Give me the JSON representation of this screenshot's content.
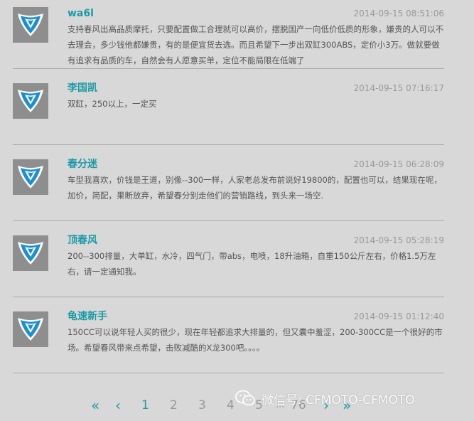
{
  "comments": [
    {
      "author": "wa6l",
      "date": "2014-09-15 08:51:06",
      "text": "支持春风出高品质摩托，只要配置做工合理就可以高价，摆脱国产一向低价低质的形象，嫌贵的人可以不去理会，多少钱他都嫌贵，有的是便宜货去选。而且希望下一步出双缸300ABS，定价小3万。做就要做有追求有品质的车，自然会有人愿意买单，定位不能局限在低端了"
    },
    {
      "author": "李国凯",
      "date": "2014-09-15 07:16:17",
      "text": "双缸，250以上，一定买"
    },
    {
      "author": "春分迷",
      "date": "2014-09-15 06:28:09",
      "text": "车型我喜欢，价钱是王道，别像--300一样，人家老总发布前说好19800的，配置也可以，结果现在呢，加价，简配，果断放弃，希望春分别走他们的营销路线，到头来一场空."
    },
    {
      "author": "顶春风",
      "date": "2014-09-15 05:28:19",
      "text": "200--300排量，大单缸，水冷，四气门，带abs，电喷，18升油箱，自重150公斤左右，价格1.5万左右，请一定通知我。"
    },
    {
      "author": "龟速新手",
      "date": "2014-09-15 01:12:40",
      "text": "150CC可以说年轻人买的很少，现在年轻都追求大排量的，但又囊中羞涩，200-300CC是一个很好的市场。希望春风带来点希望，击败减酷的X龙300吧。。。。"
    }
  ],
  "pagination": {
    "first": "«",
    "prev": "‹",
    "pages": [
      "1",
      "2",
      "3",
      "4",
      "5"
    ],
    "ellipsis": "...",
    "last_page": "76",
    "next": "›",
    "last": "»",
    "current": "1"
  },
  "watermark": {
    "text": "微信号: CFMOTO-CFMOTO"
  },
  "colors": {
    "accent": "#1b9aa6",
    "background": "#d8d8d8",
    "avatar_bg": "#8e8e8e",
    "logo_blue": "#1a8fd6"
  }
}
